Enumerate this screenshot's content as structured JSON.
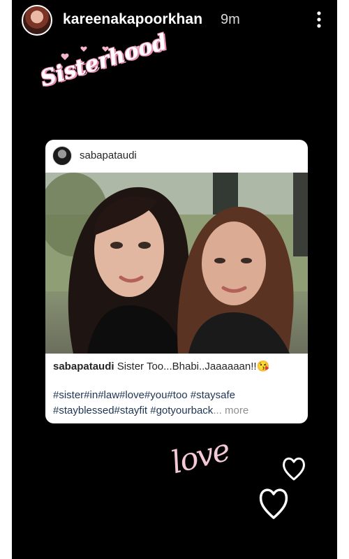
{
  "story": {
    "username": "kareenakapoorkhan",
    "time_ago": "9m",
    "menu_icon": "more-vertical-icon"
  },
  "stickers": {
    "sisterhood": "Sisterhood",
    "love": "love",
    "accent_pink": "#e98fb1"
  },
  "post": {
    "username": "sabapataudi",
    "caption_user": "sabapataudi",
    "caption_text": " Sister Too...Bhabi..Jaaaaaan!!😘",
    "hashtags_line1": "#sister#in#law#love#you#too #staysafe",
    "hashtags_line2": "#stayblessed#stayfit  #gotyourback",
    "ellipsis": "...",
    "more_label": " more"
  }
}
